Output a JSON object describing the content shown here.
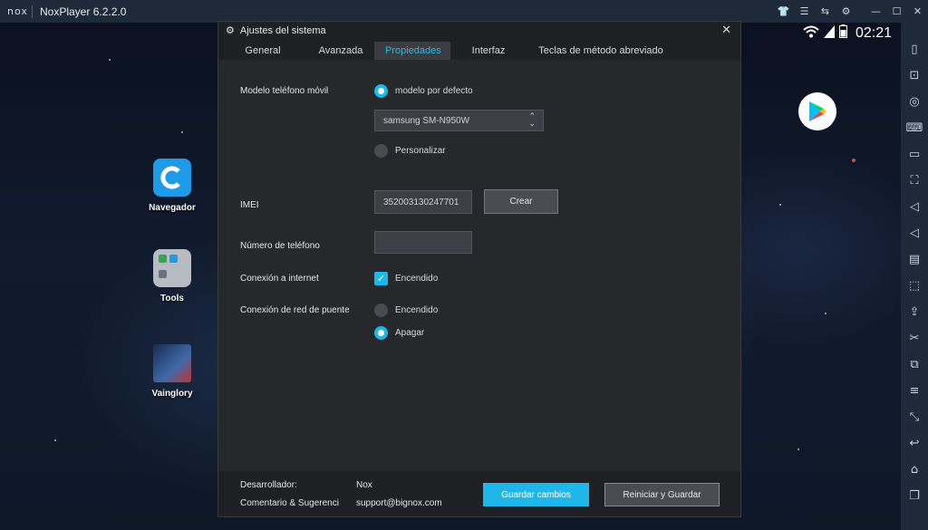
{
  "window": {
    "logo_text": "nox",
    "title": "NoxPlayer 6.2.2.0",
    "controls": [
      "shirt-icon",
      "menu-icon",
      "share-icon",
      "gear-icon",
      "minimize-icon",
      "maximize-icon",
      "close-icon"
    ]
  },
  "status_bar": {
    "time": "02:21"
  },
  "desktop_icons": [
    {
      "label": "Navegador",
      "color": "#1e9be8"
    },
    {
      "label": "Tools",
      "color": "#b7bcc2"
    },
    {
      "label": "Vainglory",
      "color": "#2a3d6a"
    }
  ],
  "dialog": {
    "title": "Ajustes del sistema",
    "tabs": [
      {
        "label": "General"
      },
      {
        "label": "Avanzada"
      },
      {
        "label": "Propiedades"
      },
      {
        "label": "Interfaz"
      },
      {
        "label": "Teclas de método abreviado"
      }
    ],
    "active_tab": "Propiedades",
    "phone_model": {
      "label": "Modelo teléfono móvil",
      "default_option": "modelo por defecto",
      "selected_model": "samsung SM-N950W",
      "custom_option": "Personalizar"
    },
    "imei": {
      "label": "IMEI",
      "value": "352003130247701",
      "create_button": "Crear"
    },
    "phone_number": {
      "label": "Número de teléfono",
      "value": ""
    },
    "internet": {
      "label": "Conexión a internet",
      "option": "Encendido",
      "checked": true
    },
    "bridge": {
      "label": "Conexión de red de puente",
      "on_option": "Encendido",
      "off_option": "Apagar",
      "selected": "Apagar"
    },
    "footer": {
      "developer_label": "Desarrollador:",
      "developer_value": "Nox",
      "feedback_label": "Comentario & Sugerenci",
      "feedback_value": "support@bignox.com",
      "save_button": "Guardar cambios",
      "restart_button": "Reiniciar y Guardar"
    }
  },
  "colors": {
    "accent": "#1fb7ea",
    "dialog_bg": "#27282c",
    "titlebar_bg": "#1e2a3a"
  }
}
